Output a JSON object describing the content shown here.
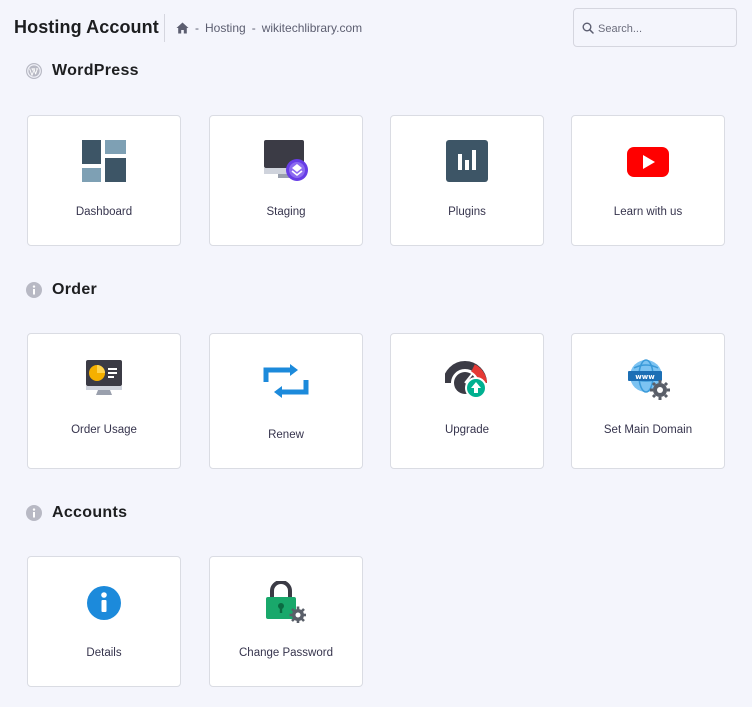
{
  "header": {
    "title": "Hosting Account",
    "breadcrumb": {
      "home_icon": "home-icon",
      "sep": "-",
      "items": [
        "Hosting",
        "wikitechlibrary.com"
      ]
    },
    "search": {
      "placeholder": "Search..."
    }
  },
  "sections": [
    {
      "title": "WordPress",
      "icon": "wordpress-icon",
      "items": [
        {
          "label": "Dashboard",
          "icon": "dashboard-icon"
        },
        {
          "label": "Staging",
          "icon": "staging-icon"
        },
        {
          "label": "Plugins",
          "icon": "plugins-icon"
        },
        {
          "label": "Learn with us",
          "icon": "youtube-icon"
        }
      ]
    },
    {
      "title": "Order",
      "icon": "info-icon",
      "items": [
        {
          "label": "Order Usage",
          "icon": "order-usage-icon"
        },
        {
          "label": "Renew",
          "icon": "renew-icon"
        },
        {
          "label": "Upgrade",
          "icon": "upgrade-icon"
        },
        {
          "label": "Set Main Domain",
          "icon": "set-main-domain-icon"
        }
      ]
    },
    {
      "title": "Accounts",
      "icon": "info-icon",
      "items": [
        {
          "label": "Details",
          "icon": "details-icon"
        },
        {
          "label": "Change Password",
          "icon": "change-password-icon"
        }
      ]
    }
  ],
  "colors": {
    "background": "#f4f5fc",
    "card_border": "#dadce3",
    "dark_slate": "#3d5566",
    "brand_purple": "#673de6",
    "youtube_red": "#ff0000",
    "renew_blue": "#1c8adb",
    "upgrade_green": "#00b090",
    "lock_green": "#19a86b"
  }
}
